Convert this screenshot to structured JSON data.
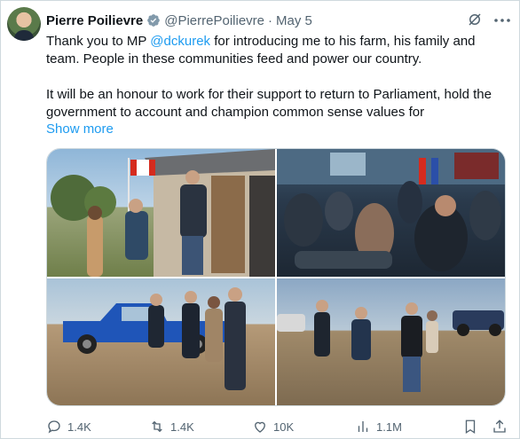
{
  "author": {
    "name": "Pierre Poilievre",
    "handle": "@PierrePoilievre",
    "separator": "·",
    "date": "May 5"
  },
  "post": {
    "line1_before": "Thank you to MP ",
    "mention": "@dckurek",
    "line1_after": " for introducing me to his farm, his family and team. People in these communities feed and power our country.",
    "paragraph2": "It will be an honour to work for their support to return to Parliament, hold the government to account and champion common sense values for",
    "show_more": "Show more"
  },
  "media": {
    "photos": [
      {
        "name": "photo-farmhouse-handshake"
      },
      {
        "name": "photo-indoor-gathering"
      },
      {
        "name": "photo-blue-truck-group"
      },
      {
        "name": "photo-field-greeting"
      }
    ]
  },
  "actions": {
    "replies": "1.4K",
    "reposts": "1.4K",
    "likes": "10K",
    "views": "1.1M"
  },
  "colors": {
    "accent": "#1d9bf0",
    "secondary_text": "#536471",
    "verified": "#829aab"
  }
}
